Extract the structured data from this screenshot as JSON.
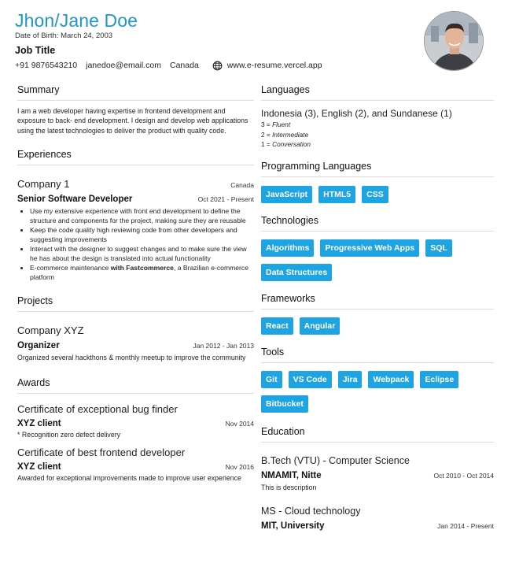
{
  "header": {
    "name": "Jhon/Jane Doe",
    "dob": "Date of Birth: March 24, 2003",
    "job_title": "Job Title",
    "phone": "+91 9876543210",
    "email": "janedoe@email.com",
    "location": "Canada",
    "website": "www.e-resume.vercel.app"
  },
  "summary": {
    "title": "Summary",
    "text": "I am a web developer having expertise in frontend development and exposure to back- end development. I design and develop web applications using the latest technologies to deliver the product with quality code."
  },
  "experiences": {
    "title": "Experiences",
    "items": [
      {
        "company": "Company 1",
        "location": "Canada",
        "role": "Senior Software Developer",
        "dates": "Oct 2021 - Present",
        "bullets": [
          "Use my extensive experience with front end development to define the structure and components for the project, making sure they are reusable",
          "Keep the code quality high reviewing code from other developers and suggesting improvements",
          "Interact with the designer to suggest changes and to make sure the view he has about the design is translated into actual functionality",
          "E-commerce maintenance ",
          "with Fastcommerce",
          ", a Brazilian e-commerce platform"
        ]
      }
    ]
  },
  "projects": {
    "title": "Projects",
    "items": [
      {
        "name": "Company XYZ",
        "role": "Organizer",
        "dates": "Jan 2012 - Jan 2013",
        "description": "Organized several hackthons & monthly meetup to improve the community"
      }
    ]
  },
  "awards": {
    "title": "Awards",
    "items": [
      {
        "name": "Certificate of exceptional bug finder",
        "issuer": "XYZ client",
        "date": "Nov 2014",
        "description": "* Recognition zero defect delivery"
      },
      {
        "name": "Certificate of best frontend developer",
        "issuer": "XYZ client",
        "date": "Nov 2016",
        "description": "Awarded for exceptional improvements made to improve user experience"
      }
    ]
  },
  "languages": {
    "title": "Languages",
    "line": "Indonesia (3), English (2), and Sundanese (1)",
    "legend": [
      {
        "num": "3 = ",
        "label": "Fluent"
      },
      {
        "num": "2 = ",
        "label": "Intermediate"
      },
      {
        "num": "1 = ",
        "label": "Conversation"
      }
    ]
  },
  "programming_languages": {
    "title": "Programming Languages",
    "tags": [
      "JavaScript",
      "HTML5",
      "CSS"
    ]
  },
  "technologies": {
    "title": "Technologies",
    "tags": [
      "Algorithms",
      "Progressive Web Apps",
      "SQL",
      "Data Structures"
    ]
  },
  "frameworks": {
    "title": "Frameworks",
    "tags": [
      "React",
      "Angular"
    ]
  },
  "tools": {
    "title": "Tools",
    "tags": [
      "Git",
      "VS Code",
      "Jira",
      "Webpack",
      "Eclipse",
      "Bitbucket"
    ]
  },
  "education": {
    "title": "Education",
    "items": [
      {
        "degree": "B.Tech (VTU) - Computer Science",
        "institution": "NMAMIT, Nitte",
        "dates": "Oct 2010 - Oct 2014",
        "description": "This is description"
      },
      {
        "degree": "MS - Cloud technology",
        "institution": "MIT, University",
        "dates": "Jan 2014 - Present",
        "description": ""
      }
    ]
  },
  "colors": {
    "accent": "#2196c9",
    "tag_bg": "#1ea3e3"
  },
  "icons": {
    "website": "globe-icon",
    "photo": "profile-photo"
  }
}
